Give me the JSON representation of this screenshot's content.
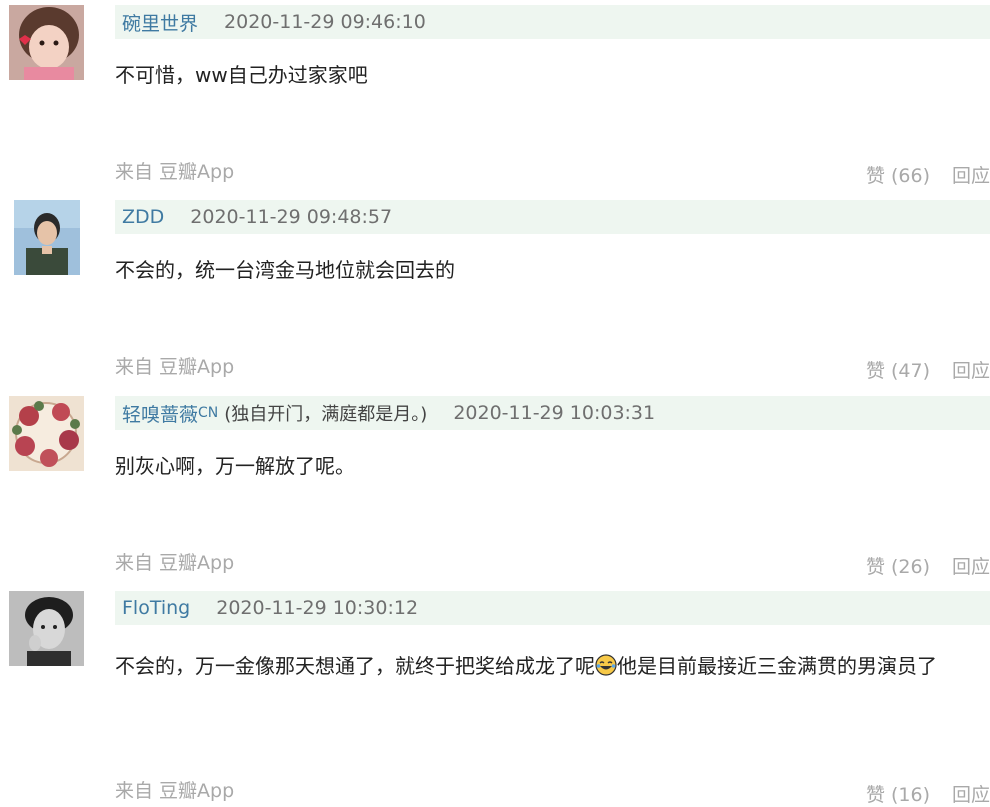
{
  "comments": [
    {
      "author": "碗里世界",
      "signature": "",
      "time": "2020-11-29 09:46:10",
      "content": "不可惜，ww自己办过家家吧",
      "source": "来自 豆瓣App",
      "likes": "赞 (66)",
      "reply": "回应",
      "avatar": "avatar-girl-pink"
    },
    {
      "author": "ZDD",
      "signature": "",
      "time": "2020-11-29 09:48:57",
      "content": "不会的，统一台湾金马地位就会回去的",
      "source": "来自 豆瓣App",
      "likes": "赞 (47)",
      "reply": "回应",
      "avatar": "avatar-man-blue"
    },
    {
      "author": "轻嗅蔷薇",
      "cn_badge": "CN",
      "signature": "(独自开门，满庭都是月。)",
      "time": "2020-11-29 10:03:31",
      "content": "别灰心啊，万一解放了呢。",
      "source": "来自 豆瓣App",
      "likes": "赞 (26)",
      "reply": "回应",
      "avatar": "avatar-roses"
    },
    {
      "author": "FloTing",
      "signature": "",
      "time": "2020-11-29 10:30:12",
      "content_before": "不会的，万一金像那天想通了，就终于把奖给成龙了呢",
      "content_after": "他是目前最接近三金满贯的男演员了",
      "emoji": "laugh-tears-emoji",
      "source": "来自 豆瓣App",
      "likes": "赞 (16)",
      "reply": "回应",
      "avatar": "avatar-bw-portrait"
    }
  ],
  "colors": {
    "author": "#3f7aa2",
    "header_bg": "#eef6f0",
    "meta_gray": "#a9a9a9"
  }
}
